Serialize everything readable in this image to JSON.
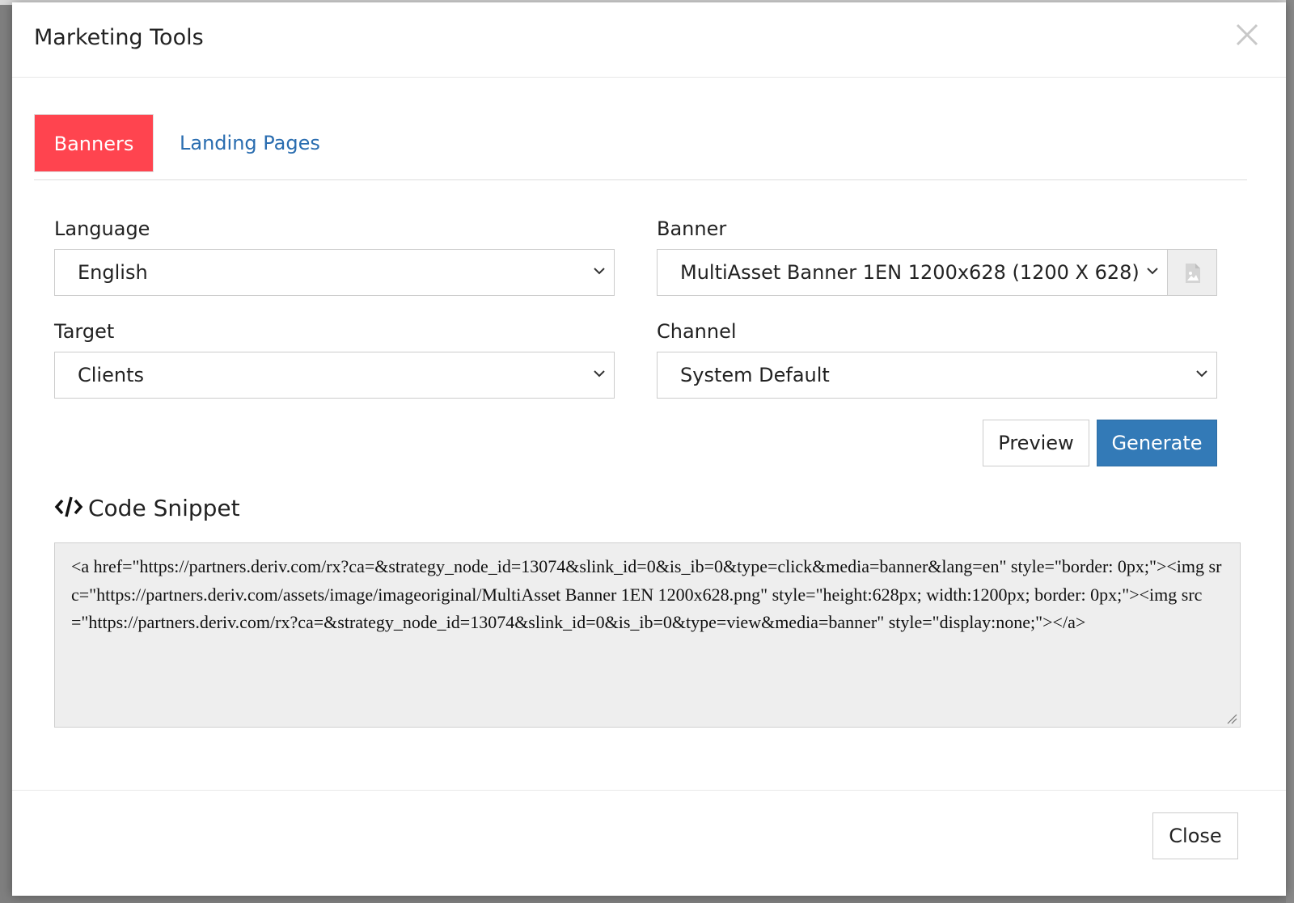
{
  "modal": {
    "title": "Marketing Tools",
    "close_icon": "close-icon"
  },
  "tabs": [
    {
      "label": "Banners",
      "active": true
    },
    {
      "label": "Landing Pages",
      "active": false
    }
  ],
  "form": {
    "language": {
      "label": "Language",
      "value": "English"
    },
    "banner": {
      "label": "Banner",
      "value": "MultiAsset Banner 1EN 1200x628 (1200 X 628)",
      "addon_icon": "image-file-icon"
    },
    "target": {
      "label": "Target",
      "value": "Clients"
    },
    "channel": {
      "label": "Channel",
      "value": "System Default"
    }
  },
  "actions": {
    "preview_label": "Preview",
    "generate_label": "Generate"
  },
  "snippet": {
    "heading": "Code Snippet",
    "icon": "code-icon",
    "code": "<a href=\"https://partners.deriv.com/rx?ca=&strategy_node_id=13074&slink_id=0&is_ib=0&type=click&media=banner&lang=en\" style=\"border: 0px;\"><img src=\"https://partners.deriv.com/assets/image/imageoriginal/MultiAsset Banner 1EN 1200x628.png\" style=\"height:628px; width:1200px; border: 0px;\"><img src=\"https://partners.deriv.com/rx?ca=&strategy_node_id=13074&slink_id=0&is_ib=0&type=view&media=banner\" style=\"display:none;\"></a>"
  },
  "footer": {
    "close_label": "Close"
  },
  "colors": {
    "active_tab": "#ff444f",
    "link": "#2a6db0",
    "primary_button": "#337ab7"
  }
}
